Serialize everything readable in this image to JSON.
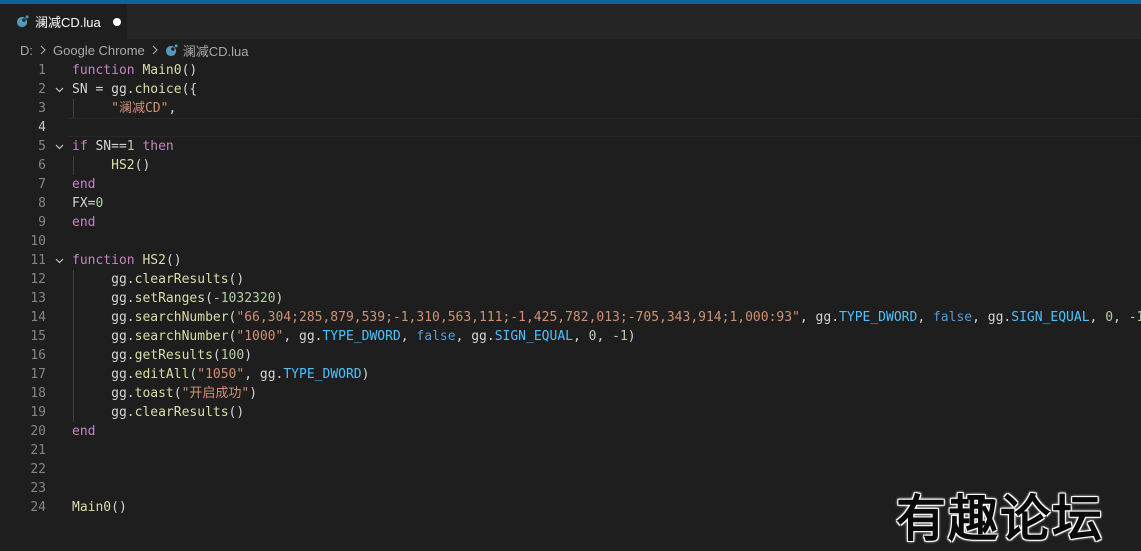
{
  "tab": {
    "title": "澜减CD.lua"
  },
  "breadcrumb": {
    "drive": "D:",
    "folder": "Google Chrome",
    "file": "澜减CD.lua"
  },
  "watermark": "有趣论坛",
  "colors": {
    "keyword": "#c586c0",
    "function": "#dcdcaa",
    "string": "#ce9178",
    "number": "#b5cea8",
    "property": "#9cdcfe",
    "constant": "#4fc1ff",
    "boolean": "#569cd6"
  },
  "code": {
    "lines": [
      {
        "n": "1",
        "tokens": [
          [
            "kw",
            "function"
          ],
          [
            "",
            " "
          ],
          [
            "fn",
            "Main0"
          ],
          [
            "",
            "()"
          ]
        ]
      },
      {
        "n": "2",
        "tokens": [
          [
            "",
            "SN = gg."
          ],
          [
            "fn",
            "choice"
          ],
          [
            "",
            "({"
          ]
        ]
      },
      {
        "n": "3",
        "tokens": [
          [
            "",
            "     "
          ],
          [
            "str",
            "\"澜减CD\""
          ],
          [
            "",
            ","
          ]
        ]
      },
      {
        "n": "4",
        "tokens": []
      },
      {
        "n": "5",
        "tokens": [
          [
            "kw",
            "if"
          ],
          [
            "",
            " SN=="
          ],
          [
            "num",
            "1"
          ],
          [
            "",
            " "
          ],
          [
            "kw",
            "then"
          ]
        ]
      },
      {
        "n": "6",
        "tokens": [
          [
            "",
            "     "
          ],
          [
            "fn",
            "HS2"
          ],
          [
            "",
            "()"
          ]
        ]
      },
      {
        "n": "7",
        "tokens": [
          [
            "kw",
            "end"
          ]
        ]
      },
      {
        "n": "8",
        "tokens": [
          [
            "",
            "FX="
          ],
          [
            "num",
            "0"
          ]
        ]
      },
      {
        "n": "9",
        "tokens": [
          [
            "kw",
            "end"
          ]
        ]
      },
      {
        "n": "10",
        "tokens": []
      },
      {
        "n": "11",
        "tokens": [
          [
            "kw",
            "function"
          ],
          [
            "",
            " "
          ],
          [
            "fn",
            "HS2"
          ],
          [
            "",
            "()"
          ]
        ]
      },
      {
        "n": "12",
        "tokens": [
          [
            "",
            "     gg."
          ],
          [
            "fn",
            "clearResults"
          ],
          [
            "",
            "()"
          ]
        ]
      },
      {
        "n": "13",
        "tokens": [
          [
            "",
            "     gg."
          ],
          [
            "fn",
            "setRanges"
          ],
          [
            "",
            "("
          ],
          [
            "num",
            "-1032320"
          ],
          [
            "",
            ")"
          ]
        ]
      },
      {
        "n": "14",
        "tokens": [
          [
            "",
            "     gg."
          ],
          [
            "fn",
            "searchNumber"
          ],
          [
            "",
            "("
          ],
          [
            "str",
            "\"66,304;285,879,539;-1,310,563,111;-1,425,782,013;-705,343,914;1,000:93\""
          ],
          [
            "",
            ", gg."
          ],
          [
            "const",
            "TYPE_DWORD"
          ],
          [
            "",
            ", "
          ],
          [
            "bool",
            "false"
          ],
          [
            "",
            ", gg."
          ],
          [
            "const",
            "SIGN_EQUAL"
          ],
          [
            "",
            ", "
          ],
          [
            "num",
            "0"
          ],
          [
            "",
            ", "
          ],
          [
            "num",
            "-1"
          ],
          [
            "",
            ")"
          ]
        ]
      },
      {
        "n": "15",
        "tokens": [
          [
            "",
            "     gg."
          ],
          [
            "fn",
            "searchNumber"
          ],
          [
            "",
            "("
          ],
          [
            "str",
            "\"1000\""
          ],
          [
            "",
            ", gg."
          ],
          [
            "const",
            "TYPE_DWORD"
          ],
          [
            "",
            ", "
          ],
          [
            "bool",
            "false"
          ],
          [
            "",
            ", gg."
          ],
          [
            "const",
            "SIGN_EQUAL"
          ],
          [
            "",
            ", "
          ],
          [
            "num",
            "0"
          ],
          [
            "",
            ", "
          ],
          [
            "num",
            "-1"
          ],
          [
            "",
            ")"
          ]
        ]
      },
      {
        "n": "16",
        "tokens": [
          [
            "",
            "     gg."
          ],
          [
            "fn",
            "getResults"
          ],
          [
            "",
            "("
          ],
          [
            "num",
            "100"
          ],
          [
            "",
            ")"
          ]
        ]
      },
      {
        "n": "17",
        "tokens": [
          [
            "",
            "     gg."
          ],
          [
            "fn",
            "editAll"
          ],
          [
            "",
            "("
          ],
          [
            "str",
            "\"1050\""
          ],
          [
            "",
            ", gg."
          ],
          [
            "const",
            "TYPE_DWORD"
          ],
          [
            "",
            ")"
          ]
        ]
      },
      {
        "n": "18",
        "tokens": [
          [
            "",
            "     gg."
          ],
          [
            "fn",
            "toast"
          ],
          [
            "",
            "("
          ],
          [
            "str",
            "\"开启成功\""
          ],
          [
            "",
            ")"
          ]
        ]
      },
      {
        "n": "19",
        "tokens": [
          [
            "",
            "     gg."
          ],
          [
            "fn",
            "clearResults"
          ],
          [
            "",
            "()"
          ]
        ]
      },
      {
        "n": "20",
        "tokens": [
          [
            "kw",
            "end"
          ]
        ]
      },
      {
        "n": "21",
        "tokens": []
      },
      {
        "n": "22",
        "tokens": []
      },
      {
        "n": "23",
        "tokens": []
      },
      {
        "n": "24",
        "tokens": [
          [
            "fn",
            "Main0"
          ],
          [
            "",
            "()"
          ]
        ]
      }
    ]
  }
}
